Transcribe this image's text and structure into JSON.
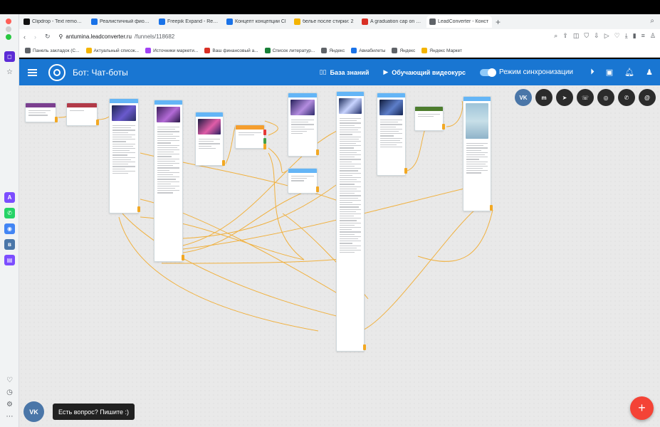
{
  "browser": {
    "tabs": [
      {
        "title": "Clipdrop - Text remover",
        "color": "#111111"
      },
      {
        "title": "Реалистичный фиолет",
        "color": "#1a73e8"
      },
      {
        "title": "Freepik Expand - Resize",
        "color": "#1a73e8"
      },
      {
        "title": "Концепт концепции Cl",
        "color": "#1a73e8"
      },
      {
        "title": "белье после стирки: 2",
        "color": "#f4b400"
      },
      {
        "title": "A graduation cap on top",
        "color": "#d93025"
      },
      {
        "title": "LeadConverter - Конст",
        "color": "#5f6368",
        "active": true
      }
    ],
    "new_tab_label": "+",
    "url_host": "antumina.leadconverter.ru",
    "url_path": "/funnels/118682",
    "bookmarks": [
      {
        "label": "Панель закладок (С...",
        "color": "#5f6368"
      },
      {
        "label": "Актуальный список...",
        "color": "#f4b400"
      },
      {
        "label": "Источники маркети...",
        "color": "#a142f4"
      },
      {
        "label": "Ваш финансовый а...",
        "color": "#d93025"
      },
      {
        "label": "Список литератур...",
        "color": "#188038"
      },
      {
        "label": "Яндекс",
        "color": "#5f6368"
      },
      {
        "label": "Авиабилеты",
        "color": "#1a73e8"
      },
      {
        "label": "Яндекс",
        "color": "#5f6368"
      },
      {
        "label": "Яндекс Маркет",
        "color": "#f4b400"
      }
    ]
  },
  "app": {
    "title": "Бот: Чат-боты",
    "knowledge_base": "База знаний",
    "video_course": "Обучающий видеокурс",
    "sync_mode": "Режим синхронизации"
  },
  "socials": [
    {
      "icon": "vk-icon",
      "label": "VK",
      "color": "#4a76a8"
    },
    {
      "icon": "messenger-icon",
      "label": "m",
      "color": "#2b2b2b"
    },
    {
      "icon": "telegram-icon",
      "label": "➤",
      "color": "#2b2b2b"
    },
    {
      "icon": "viber-icon",
      "label": "☏",
      "color": "#2b2b2b"
    },
    {
      "icon": "instagram-icon",
      "label": "◎",
      "color": "#2b2b2b"
    },
    {
      "icon": "whatsapp-icon",
      "label": "✆",
      "color": "#2b2b2b"
    },
    {
      "icon": "email-icon",
      "label": "@",
      "color": "#2b2b2b"
    }
  ],
  "chat_widget": {
    "vk_label": "VK",
    "prompt": "Есть вопрос? Пишите :)"
  },
  "fab_label": "+",
  "colors": {
    "primary": "#1976d2",
    "accent": "#f2a823",
    "fab": "#f44336"
  }
}
